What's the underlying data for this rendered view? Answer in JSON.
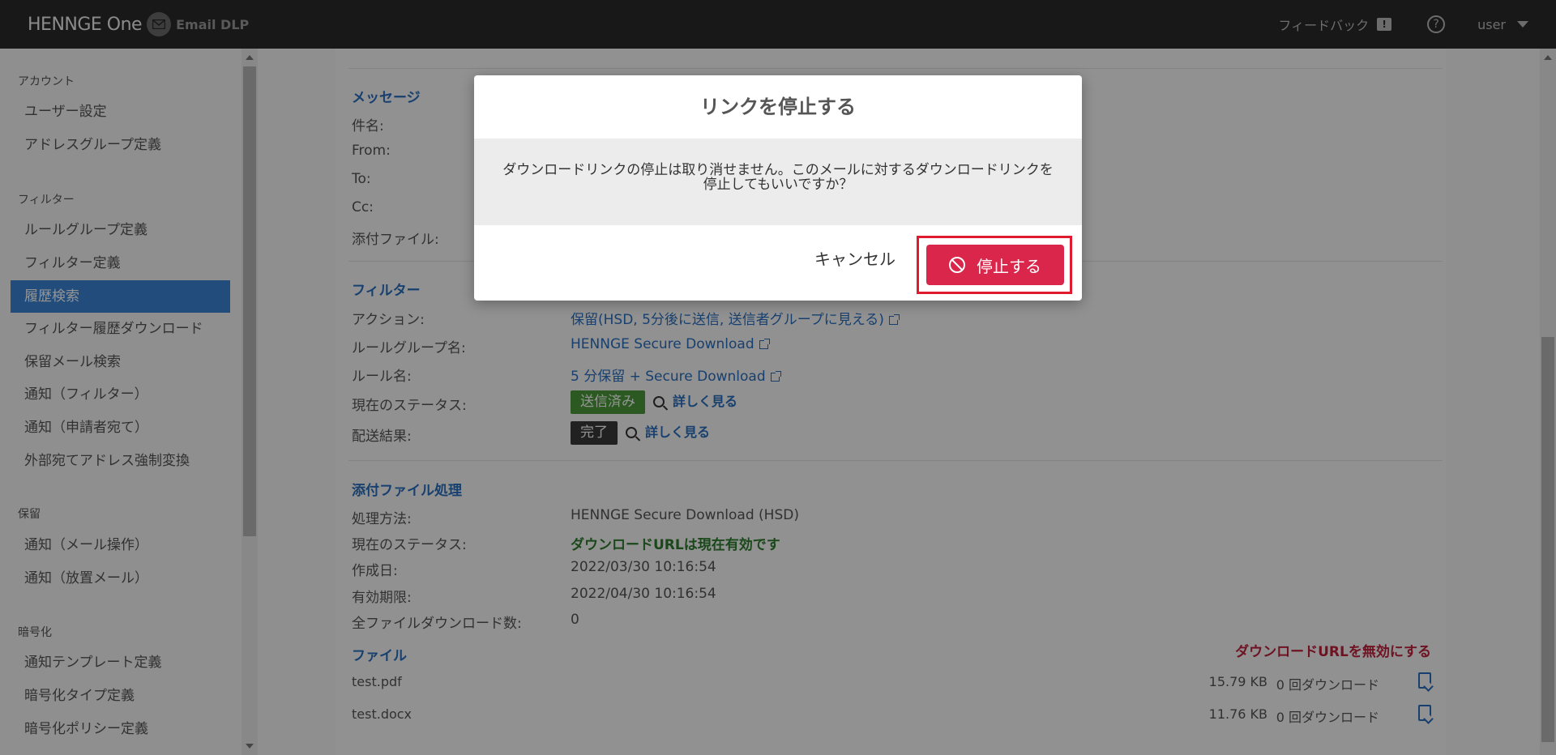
{
  "header": {
    "logo_text": "HENNGE One",
    "product": "Email DLP",
    "feedback_label": "フィードバック",
    "help_glyph": "?",
    "user_label": "user"
  },
  "sidebar": {
    "sections": [
      {
        "title": "アカウント",
        "items": [
          "ユーザー設定",
          "アドレスグループ定義"
        ]
      },
      {
        "title": "フィルター",
        "items": [
          "ルールグループ定義",
          "フィルター定義",
          "履歴検索",
          "フィルター履歴ダウンロード",
          "保留メール検索",
          "通知（フィルター）",
          "通知（申請者宛て）",
          "外部宛てアドレス強制変換"
        ]
      },
      {
        "title": "保留",
        "items": [
          "通知（メール操作）",
          "通知（放置メール）"
        ]
      },
      {
        "title": "暗号化",
        "items": [
          "通知テンプレート定義",
          "暗号化タイプ定義",
          "暗号化ポリシー定義"
        ]
      }
    ],
    "active_item": "履歴検索"
  },
  "message_section": {
    "title": "メッセージ",
    "labels": [
      "件名:",
      "From:",
      "To:",
      "Cc:",
      "添付ファイル:"
    ]
  },
  "filter_section": {
    "title": "フィルター",
    "rows": [
      {
        "label": "アクション:",
        "value": "保留(HSD, 5分後に送信, 送信者グループに見える)"
      },
      {
        "label": "ルールグループ名:",
        "value": "HENNGE Secure Download"
      },
      {
        "label": "ルール名:",
        "value": "5 分保留 + Secure Download"
      },
      {
        "label": "現在のステータス:",
        "value": "送信済み"
      },
      {
        "label": "配送結果:",
        "value": "完了"
      }
    ],
    "detail_link": "詳しく見る"
  },
  "attachment_section": {
    "title": "添付ファイル処理",
    "rows": [
      {
        "label": "処理方法:",
        "value": "HENNGE Secure Download (HSD)"
      },
      {
        "label": "現在のステータス:",
        "value": "ダウンロードURLは現在有効です"
      },
      {
        "label": "作成日:",
        "value": "2022/03/30 10:16:54"
      },
      {
        "label": "有効期限:",
        "value": "2022/04/30 10:16:54"
      },
      {
        "label": "全ファイルダウンロード数:",
        "value": "0"
      }
    ]
  },
  "files_section": {
    "title": "ファイル",
    "disable_link": "ダウンロードURLを無効にする",
    "files": [
      {
        "name": "test.pdf",
        "size": "15.79 KB",
        "downloads": "0 回ダウンロード"
      },
      {
        "name": "test.docx",
        "size": "11.76 KB",
        "downloads": "0 回ダウンロード"
      }
    ]
  },
  "modal": {
    "title": "リンクを停止する",
    "body": "ダウンロードリンクの停止は取り消せません。このメールに対するダウンロードリンクを停止してもいいですか？",
    "cancel_label": "キャンセル",
    "confirm_label": "停止する"
  },
  "colors": {
    "accent": "#3a84d4",
    "danger": "#d9264a",
    "link": "#2a6fbf",
    "status_green": "#4a9a3a"
  }
}
